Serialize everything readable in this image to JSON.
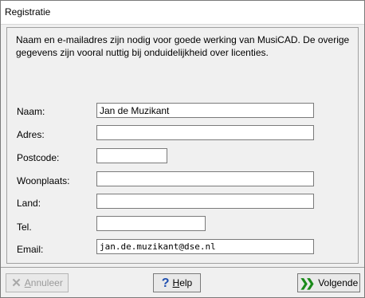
{
  "window": {
    "title": "Registratie"
  },
  "intro": "Naam en e-mailadres zijn nodig voor goede werking van MusiCAD. De overige gegevens zijn vooral nuttig bij onduidelijkheid over licenties.",
  "fields": {
    "naam": {
      "label": "Naam:",
      "value": "Jan de Muzikant"
    },
    "adres": {
      "label": "Adres:",
      "value": ""
    },
    "postcode": {
      "label": "Postcode:",
      "value": ""
    },
    "woonplaats": {
      "label": "Woonplaats:",
      "value": ""
    },
    "land": {
      "label": "Land:",
      "value": ""
    },
    "tel": {
      "label": "Tel.",
      "value": ""
    },
    "email": {
      "label": "Email:",
      "value": "jan.de.muzikant@dse.nl"
    }
  },
  "buttons": {
    "annuleer_first": "A",
    "annuleer_rest": "nnuleer",
    "help_first": "H",
    "help_rest": "elp",
    "volgende": "Volgende"
  },
  "icons": {
    "annuleer": "x-icon",
    "help": "question-icon",
    "volgende": "double-chevron-right-icon"
  },
  "colors": {
    "next_icon": "#1a8a1a",
    "help_icon": "#1f4fb0"
  }
}
